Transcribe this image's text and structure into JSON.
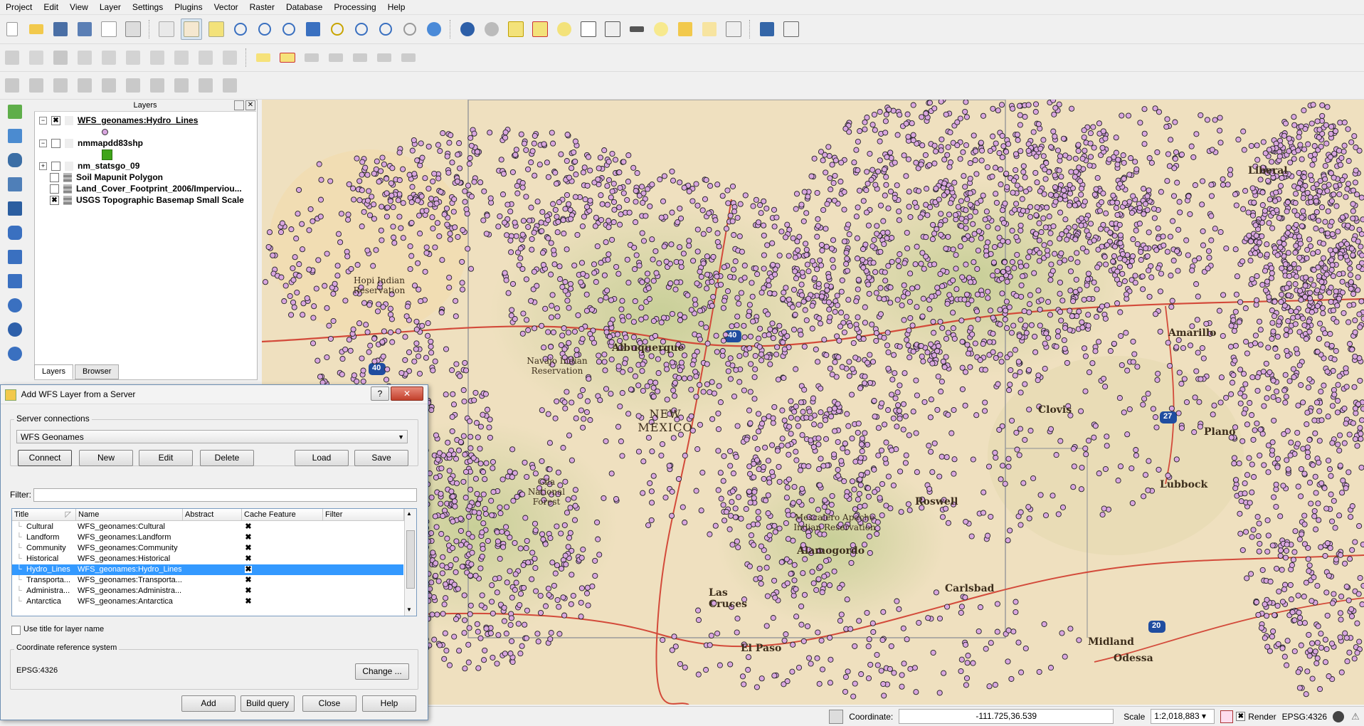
{
  "menubar": [
    "Project",
    "Edit",
    "View",
    "Layer",
    "Settings",
    "Plugins",
    "Vector",
    "Raster",
    "Database",
    "Processing",
    "Help"
  ],
  "layers_panel": {
    "title": "Layers",
    "items": [
      {
        "name": "WFS_geonames:Hydro_Lines",
        "checked": "✖",
        "expand": "−"
      },
      {
        "name": "nmmapdd83shp",
        "checked": "",
        "expand": "−"
      },
      {
        "name": "nm_statsgo_09",
        "checked": "",
        "expand": "+"
      },
      {
        "name": "Soil Mapunit Polygon",
        "checked": "",
        "expand": ""
      },
      {
        "name": "Land_Cover_Footprint_2006/Imperviou...",
        "checked": "",
        "expand": ""
      },
      {
        "name": "USGS Topographic Basemap Small Scale",
        "checked": "✖",
        "expand": ""
      }
    ],
    "tabs": [
      "Layers",
      "Browser"
    ]
  },
  "map": {
    "labels": [
      "Liberal",
      "Hopi Indian Reservation",
      "Albuquerque",
      "NEW MEXICO",
      "Clovis",
      "Lubbock",
      "Amarillo",
      "Plano",
      "Roswell",
      "Alamogordo",
      "Carlsbad",
      "Las Cruces",
      "El Paso",
      "Midland",
      "Odessa",
      "Navajo Indian Reservation",
      "Gila National Forest",
      "Mescalero Apache Indian Reservation"
    ],
    "shields": [
      "40",
      "40",
      "27",
      "20"
    ],
    "point_color": "#d9a6e0"
  },
  "statusbar": {
    "coordinate_label": "Coordinate:",
    "coordinate_value": "-111.725,36.539",
    "scale_label": "Scale",
    "scale_value": "1:2,018,883",
    "render_label": "Render",
    "crs": "EPSG:4326"
  },
  "dialog": {
    "title": "Add WFS Layer from a Server",
    "server_group": "Server connections",
    "server_selected": "WFS Geonames",
    "buttons": {
      "connect": "Connect",
      "new": "New",
      "edit": "Edit",
      "delete": "Delete",
      "load": "Load",
      "save": "Save"
    },
    "filter_label": "Filter:",
    "columns": [
      "Title",
      "Name",
      "Abstract",
      "Cache Feature",
      "Filter"
    ],
    "rows": [
      {
        "title": "Cultural",
        "name": "WFS_geonames:Cultural",
        "cache": "✖"
      },
      {
        "title": "Landform",
        "name": "WFS_geonames:Landform",
        "cache": "✖"
      },
      {
        "title": "Community",
        "name": "WFS_geonames:Community",
        "cache": "✖"
      },
      {
        "title": "Historical",
        "name": "WFS_geonames:Historical",
        "cache": "✖"
      },
      {
        "title": "Hydro_Lines",
        "name": "WFS_geonames:Hydro_Lines",
        "cache": "✖"
      },
      {
        "title": "Transporta...",
        "name": "WFS_geonames:Transporta...",
        "cache": "✖"
      },
      {
        "title": "Administra...",
        "name": "WFS_geonames:Administra...",
        "cache": "✖"
      },
      {
        "title": "Antarctica",
        "name": "WFS_geonames:Antarctica",
        "cache": "✖"
      }
    ],
    "use_title_label": "Use title for layer name",
    "crs_group": "Coordinate reference system",
    "crs_value": "EPSG:4326",
    "change_button": "Change ...",
    "footer": {
      "add": "Add",
      "build_query": "Build query",
      "close": "Close",
      "help": "Help"
    },
    "help_glyph": "?",
    "close_glyph": "✕"
  }
}
